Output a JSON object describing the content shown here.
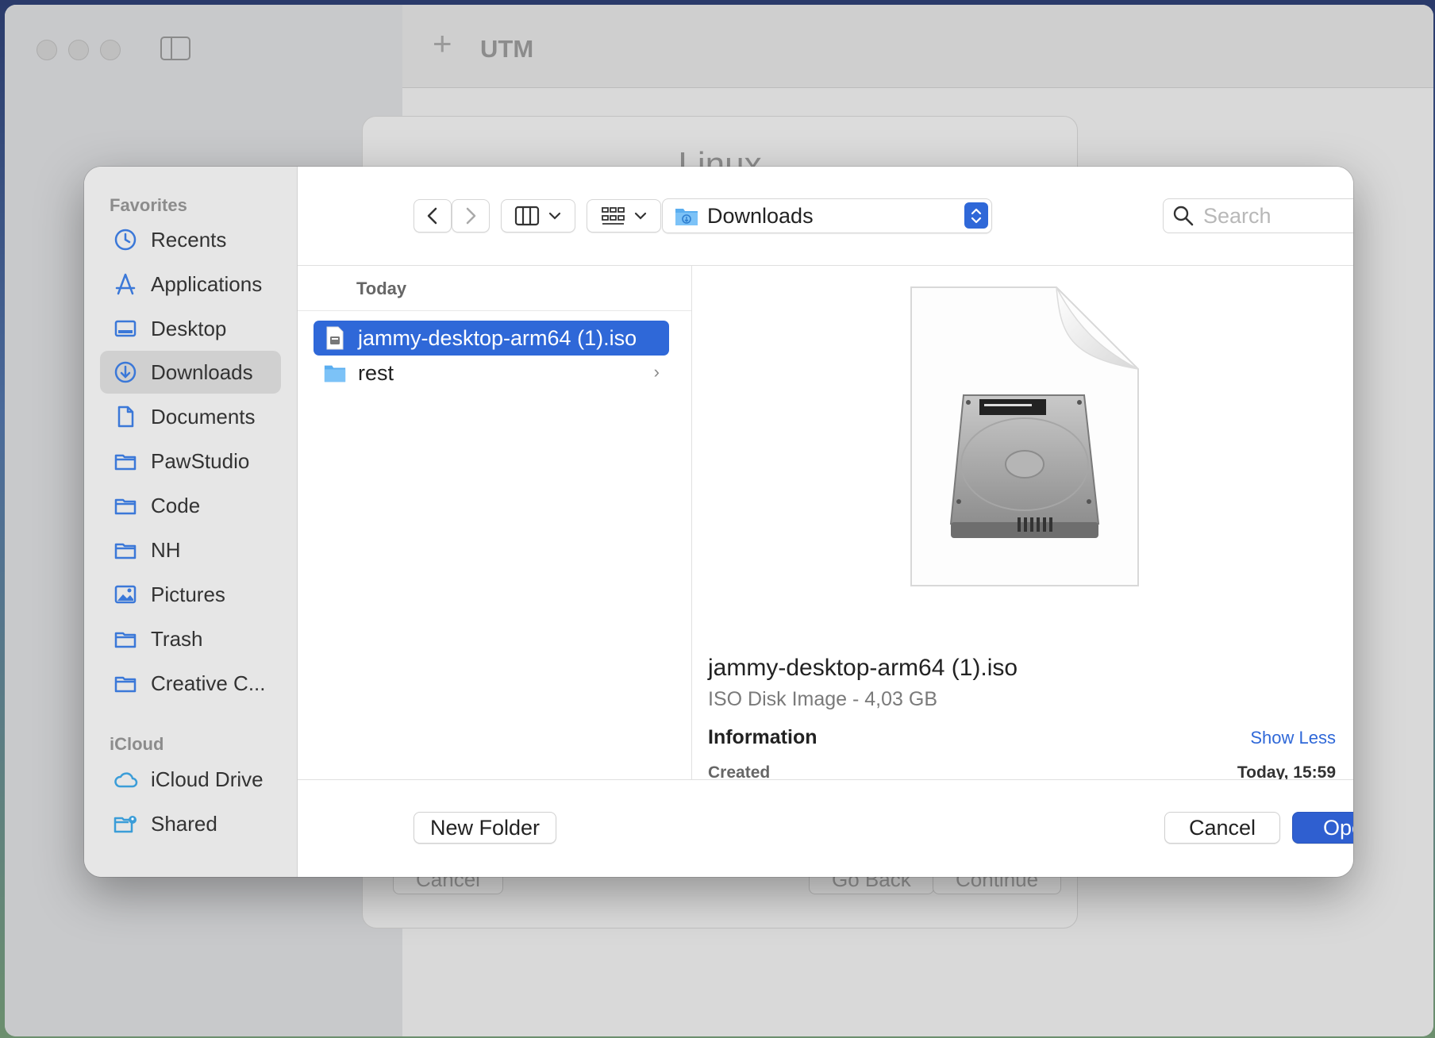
{
  "background_app": {
    "title": "UTM",
    "add_icon": "plus-icon",
    "wizard": {
      "title": "Linux",
      "cancel_label": "Cancel",
      "go_back_label": "Go Back",
      "continue_label": "Continue"
    }
  },
  "sidebar": {
    "favorites_title": "Favorites",
    "favorites": [
      {
        "label": "Recents",
        "icon": "clock-icon"
      },
      {
        "label": "Applications",
        "icon": "applications-icon"
      },
      {
        "label": "Desktop",
        "icon": "desktop-icon"
      },
      {
        "label": "Downloads",
        "icon": "download-icon",
        "selected": true
      },
      {
        "label": "Documents",
        "icon": "document-icon"
      },
      {
        "label": "PawStudio",
        "icon": "folder-icon"
      },
      {
        "label": "Code",
        "icon": "folder-icon"
      },
      {
        "label": "NH",
        "icon": "folder-icon"
      },
      {
        "label": "Pictures",
        "icon": "pictures-icon"
      },
      {
        "label": "Trash",
        "icon": "folder-icon"
      },
      {
        "label": "Creative C...",
        "icon": "folder-icon"
      }
    ],
    "icloud_title": "iCloud",
    "icloud": [
      {
        "label": "iCloud Drive",
        "icon": "cloud-icon"
      },
      {
        "label": "Shared",
        "icon": "shared-folder-icon"
      }
    ]
  },
  "toolbar": {
    "location": "Downloads",
    "search_placeholder": "Search"
  },
  "file_list": {
    "group_header": "Today",
    "items": [
      {
        "name": "jammy-desktop-arm64 (1).iso",
        "icon": "disk-image-icon",
        "selected": true
      },
      {
        "name": "rest",
        "icon": "folder-icon",
        "has_children": true
      }
    ]
  },
  "preview": {
    "file_name": "jammy-desktop-arm64 (1).iso",
    "kind_size": "ISO Disk Image - 4,03 GB",
    "info_title": "Information",
    "show_less_label": "Show Less",
    "created_label": "Created",
    "created_value": "Today, 15:59"
  },
  "footer": {
    "new_folder_label": "New Folder",
    "cancel_label": "Cancel",
    "open_label": "Open"
  },
  "colors": {
    "accent": "#2f68d8",
    "primary_button": "#2f5fd0",
    "sidebar_selected": "#d0d0d0",
    "sidebar_icon": "#3b78d8"
  }
}
